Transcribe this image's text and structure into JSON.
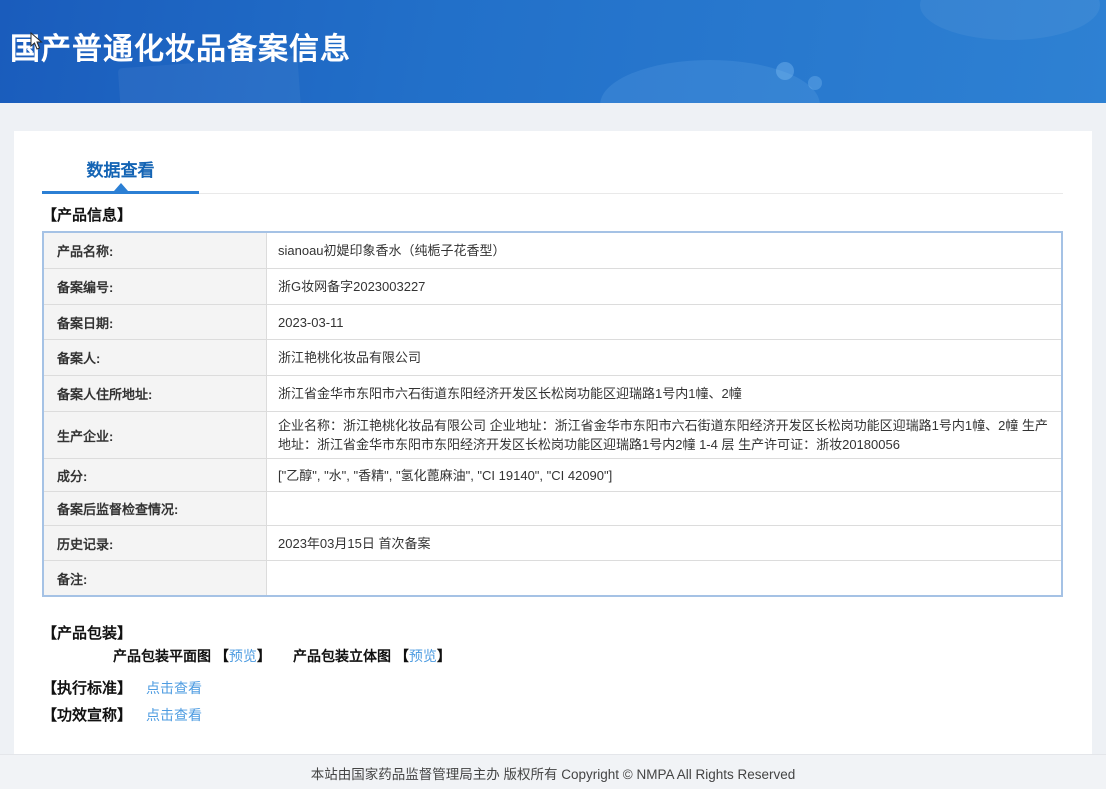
{
  "header": {
    "title": "国产普通化妆品备案信息"
  },
  "tabs": {
    "data_view": "数据查看"
  },
  "sections": {
    "product_info": "【产品信息】",
    "product_packaging": "【产品包装】",
    "execution_standard": "【执行标准】",
    "efficacy_claim": "【功效宣称】"
  },
  "product_table": {
    "rows": [
      {
        "label": "产品名称:",
        "value": "sianoau初媞印象香水（纯栀子花香型）"
      },
      {
        "label": "备案编号:",
        "value": "浙G妆网备字2023003227"
      },
      {
        "label": "备案日期:",
        "value": "2023-03-11"
      },
      {
        "label": "备案人:",
        "value": "浙江艳桃化妆品有限公司"
      },
      {
        "label": "备案人住所地址:",
        "value": "浙江省金华市东阳市六石街道东阳经济开发区长松岗功能区迎瑞路1号内1幢、2幢"
      },
      {
        "label": "生产企业:",
        "value": "企业名称：浙江艳桃化妆品有限公司 企业地址：浙江省金华市东阳市六石街道东阳经济开发区长松岗功能区迎瑞路1号内1幢、2幢 生产地址：浙江省金华市东阳市东阳经济开发区长松岗功能区迎瑞路1号内2幢 1-4 层 生产许可证：浙妆20180056"
      },
      {
        "label": "成分:",
        "value": "[\"乙醇\", \"水\", \"香精\", \"氢化蓖麻油\", \"CI 19140\", \"CI 42090\"]"
      },
      {
        "label": "备案后监督检查情况:",
        "value": ""
      },
      {
        "label": "历史记录:",
        "value": "2023年03月15日 首次备案"
      },
      {
        "label": "备注:",
        "value": ""
      }
    ]
  },
  "packaging": {
    "flat_label": "产品包装平面图",
    "stereo_label": "产品包装立体图",
    "bracket_open": "【",
    "bracket_close": "】",
    "preview": "预览"
  },
  "links": {
    "click_to_view": "点击查看"
  },
  "footer": {
    "text": "本站由国家药品监督管理局主办 版权所有 Copyright © NMPA All Rights Reserved"
  },
  "colors": {
    "header_gradient_start": "#1a5cbc",
    "header_gradient_end": "#2e81d3",
    "tab_accent": "#1464b4",
    "tab_underline": "#2b7fd4",
    "link_blue": "#4e9ce1",
    "table_border": "#a5c2e5",
    "label_cell_bg": "#f4f4f4",
    "page_bg": "#eef1f5"
  }
}
